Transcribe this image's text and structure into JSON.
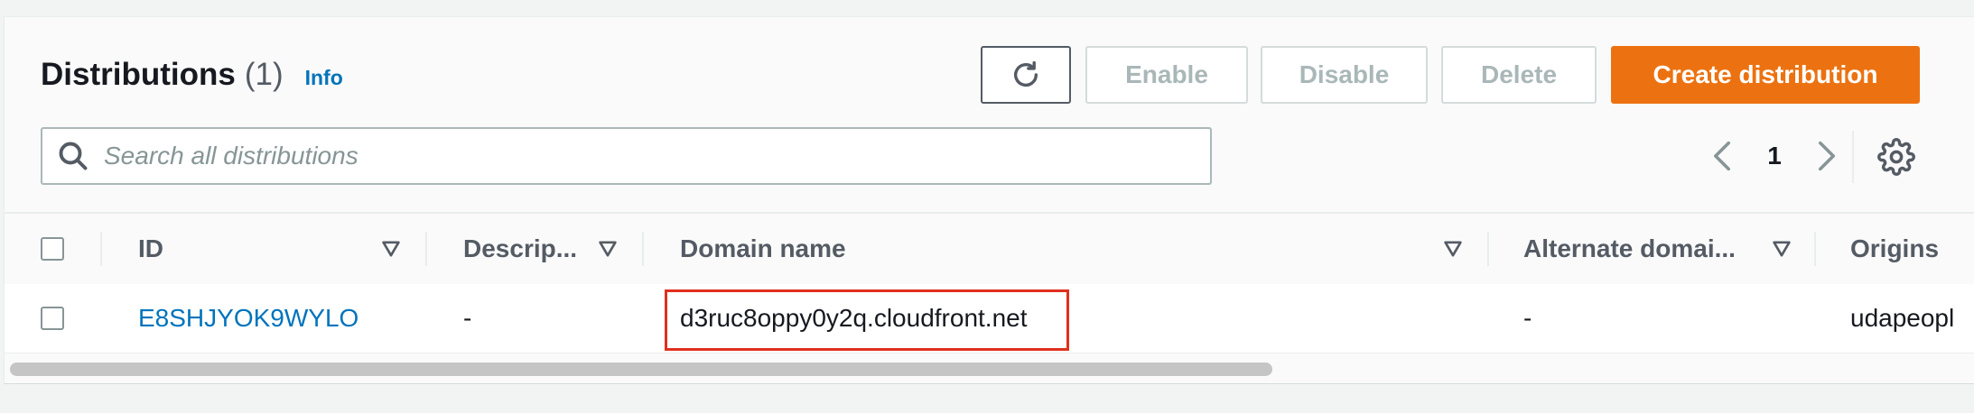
{
  "header": {
    "title": "Distributions",
    "count": "(1)",
    "info_link": "Info"
  },
  "toolbar": {
    "refresh_icon": "refresh-icon",
    "enable_label": "Enable",
    "disable_label": "Disable",
    "delete_label": "Delete",
    "create_label": "Create distribution",
    "primary_color": "#ec7211"
  },
  "search": {
    "placeholder": "Search all distributions",
    "value": ""
  },
  "pagination": {
    "current_page": "1"
  },
  "table": {
    "columns": [
      "ID",
      "Descrip...",
      "Domain name",
      "Alternate domai...",
      "Origins"
    ],
    "rows": [
      {
        "id": "E8SHJYOK9WYLO",
        "description": "-",
        "domain_name": "d3ruc8oppy0y2q.cloudfront.net",
        "alternate_domain": "-",
        "origins": "udapeopl"
      }
    ],
    "highlight_color": "#e0301e"
  }
}
